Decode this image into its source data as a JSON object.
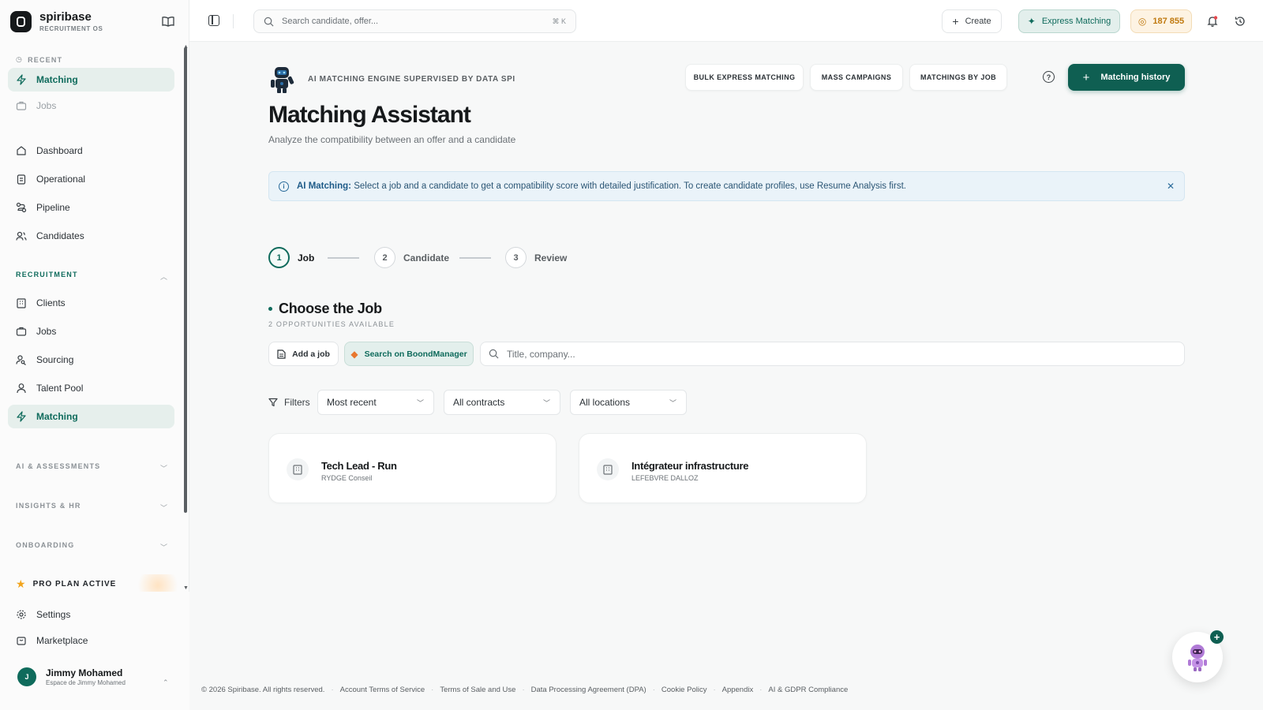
{
  "brand": {
    "name": "spiribase",
    "subtitle": "RECRUITMENT OS"
  },
  "sidebar": {
    "recent_label": "RECENT",
    "recent_items": [
      {
        "label": "Matching",
        "icon": "bolt-icon",
        "active": true
      },
      {
        "label": "Jobs",
        "icon": "briefcase-icon",
        "active": false
      }
    ],
    "main_items": [
      {
        "label": "Dashboard",
        "icon": "home-icon"
      },
      {
        "label": "Operational",
        "icon": "clipboard-icon"
      },
      {
        "label": "Pipeline",
        "icon": "pipeline-icon"
      },
      {
        "label": "Candidates",
        "icon": "users-icon"
      }
    ],
    "recruitment_label": "RECRUITMENT",
    "recruitment_items": [
      {
        "label": "Clients",
        "icon": "building-icon"
      },
      {
        "label": "Jobs",
        "icon": "briefcase-icon"
      },
      {
        "label": "Sourcing",
        "icon": "user-search-icon"
      },
      {
        "label": "Talent Pool",
        "icon": "user-icon"
      },
      {
        "label": "Matching",
        "icon": "bolt-icon",
        "active": true
      }
    ],
    "collapsed_sections": [
      "AI & ASSESSMENTS",
      "INSIGHTS & HR",
      "ONBOARDING"
    ],
    "pro_plan": "PRO PLAN ACTIVE",
    "bottom_items": [
      {
        "label": "Settings",
        "icon": "gear-icon"
      },
      {
        "label": "Marketplace",
        "icon": "store-icon"
      }
    ],
    "user": {
      "initial": "J",
      "name": "Jimmy Mohamed",
      "workspace": "Espace de Jimmy Mohamed"
    }
  },
  "topbar": {
    "search_placeholder": "Search candidate, offer...",
    "shortcut": "⌘ K",
    "create_label": "Create",
    "express_label": "Express Matching",
    "credits": "187 855"
  },
  "header": {
    "engine_label": "AI MATCHING ENGINE SUPERVISED BY DATA SPI",
    "buttons": [
      "BULK EXPRESS MATCHING",
      "MASS CAMPAIGNS",
      "MATCHINGS BY JOB"
    ],
    "primary_label": "Matching history",
    "title": "Matching Assistant",
    "subtitle": "Analyze the compatibility between an offer and a candidate"
  },
  "info": {
    "strong": "AI Matching:",
    "text": "Select a job and a candidate to get a compatibility score with detailed justification. To create candidate profiles, use Resume Analysis first."
  },
  "steps": [
    {
      "num": "1",
      "label": "Job",
      "active": true
    },
    {
      "num": "2",
      "label": "Candidate",
      "active": false
    },
    {
      "num": "3",
      "label": "Review",
      "active": false
    }
  ],
  "choose": {
    "title": "Choose the Job",
    "subtitle": "2 OPPORTUNITIES AVAILABLE",
    "add_label": "Add a job",
    "boond_label": "Search on BoondManager",
    "search_placeholder": "Title, company..."
  },
  "filters": {
    "label": "Filters",
    "sort": "Most recent",
    "contracts": "All contracts",
    "locations": "All locations"
  },
  "jobs": [
    {
      "title": "Tech Lead - Run",
      "company": "RYDGE Conseil"
    },
    {
      "title": "Intégrateur infrastructure",
      "company": "LEFEBVRE DALLOZ"
    }
  ],
  "footer": {
    "copyright": "© 2026 Spiribase. All rights reserved.",
    "links": [
      "Account Terms of Service",
      "Terms of Sale and Use",
      "Data Processing Agreement (DPA)",
      "Cookie Policy",
      "Appendix",
      "AI & GDPR Compliance"
    ]
  },
  "colors": {
    "accent": "#0f5f52",
    "accent_light": "#e3efec",
    "info_bg": "#eaf3f9",
    "credits": "#c07a10"
  }
}
